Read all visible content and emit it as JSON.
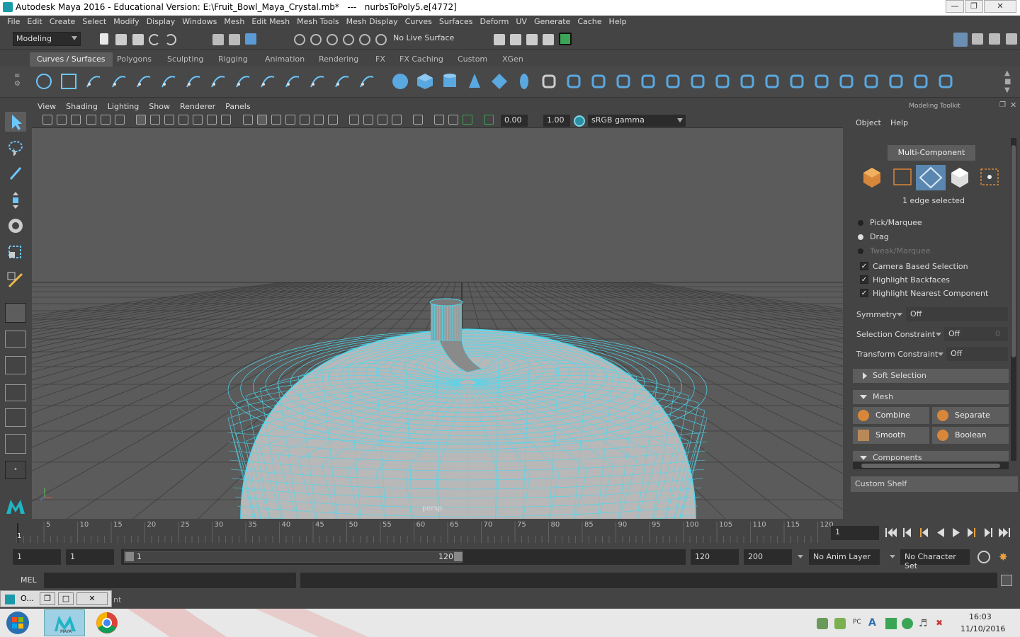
{
  "window": {
    "title": "Autodesk Maya 2016 - Educational Version: E:\\Fruit_Bowl_Maya_Crystal.mb*   ---   nurbsToPoly5.e[4772]"
  },
  "menu": [
    "File",
    "Edit",
    "Create",
    "Select",
    "Modify",
    "Display",
    "Windows",
    "Mesh",
    "Edit Mesh",
    "Mesh Tools",
    "Mesh Display",
    "Curves",
    "Surfaces",
    "Deform",
    "UV",
    "Generate",
    "Cache",
    "Help"
  ],
  "status": {
    "mode": "Modeling",
    "live_surface": "No Live Surface"
  },
  "shelf_tabs": [
    "Curves / Surfaces",
    "Polygons",
    "Sculpting",
    "Rigging",
    "Animation",
    "Rendering",
    "FX",
    "FX Caching",
    "Custom",
    "XGen"
  ],
  "viewport": {
    "menu": [
      "View",
      "Shading",
      "Lighting",
      "Show",
      "Renderer",
      "Panels"
    ],
    "exposure": "0.00",
    "gamma": "1.00",
    "color_space": "sRGB gamma",
    "camera_label": "persp"
  },
  "toolkit": {
    "header": "Modeling Toolkit",
    "menu": [
      "Object",
      "Help"
    ],
    "multi_component": "Multi-Component",
    "selected_info": "1 edge selected",
    "pick_marquee": "Pick/Marquee",
    "drag": "Drag",
    "tweak_marquee": "Tweak/Marquee",
    "camera_based": "Camera Based Selection",
    "highlight_backfaces": "Highlight Backfaces",
    "highlight_nearest": "Highlight Nearest Component",
    "symmetry_label": "Symmetry",
    "symmetry_value": "Off",
    "sel_constraint_label": "Selection Constraint",
    "sel_constraint_value": "Off",
    "sel_constraint_num": "0",
    "transform_constraint_label": "Transform Constraint",
    "transform_constraint_value": "Off",
    "soft_selection": "Soft Selection",
    "mesh_section": "Mesh",
    "combine": "Combine",
    "separate": "Separate",
    "smooth": "Smooth",
    "boolean": "Boolean",
    "components": "Components",
    "custom_shelf": "Custom Shelf"
  },
  "timeline": {
    "ticks": [
      "5",
      "10",
      "15",
      "20",
      "25",
      "30",
      "35",
      "40",
      "45",
      "50",
      "55",
      "60",
      "65",
      "70",
      "75",
      "80",
      "85",
      "90",
      "95",
      "100",
      "105",
      "110",
      "115",
      "120"
    ],
    "current_marker": "1",
    "current_frame": "1"
  },
  "range": {
    "start": "1",
    "playback_start": "1",
    "slider_start": "1",
    "slider_end": "120",
    "playback_end": "120",
    "end": "200",
    "anim_layer": "No Anim Layer",
    "character_set": "No Character Set"
  },
  "mel": {
    "label": "MEL"
  },
  "minimized": {
    "label": "O...",
    "suffix": "nt"
  },
  "clock": {
    "time": "16:03",
    "date": "11/10/2016"
  },
  "tray": {
    "pc_label": "PC",
    "maya_label": "MAYA"
  }
}
